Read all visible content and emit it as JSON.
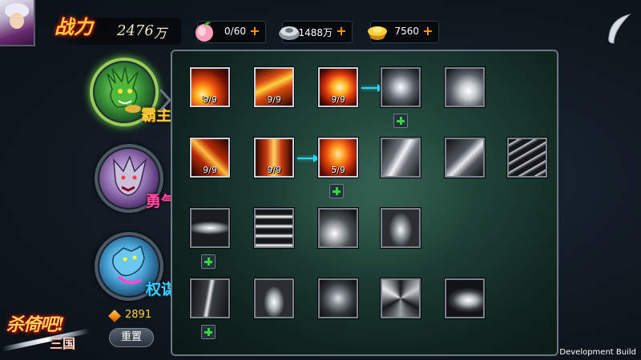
{
  "header": {
    "power_label": "战力",
    "power_value": "2476",
    "power_unit": "万",
    "resources": [
      {
        "icon": "peach-icon",
        "value": "0/60"
      },
      {
        "icon": "silver-icon",
        "value": "1488万"
      },
      {
        "icon": "gold-ingot-icon",
        "value": "7560"
      }
    ]
  },
  "specs": [
    {
      "name": "霸主",
      "icon": "dragon-icon",
      "active": true
    },
    {
      "name": "勇气",
      "icon": "wolf-icon",
      "active": false
    },
    {
      "name": "权谋",
      "icon": "serpent-icon",
      "active": false
    }
  ],
  "points": "2891",
  "reset_label": "重置",
  "logo": {
    "line1": "杀倚吧!",
    "line2": "三国"
  },
  "skills": {
    "r1c1": {
      "level": "9/9"
    },
    "r1c2": {
      "level": "9/9"
    },
    "r1c3": {
      "level": "9/9"
    },
    "r2c1": {
      "level": "9/9"
    },
    "r2c2": {
      "level": "9/9"
    },
    "r2c3": {
      "level": "5/9"
    }
  },
  "footer": {
    "dev_build": "Development Build"
  },
  "colors": {
    "accent_link": "#2ad8f2",
    "plus_green": "#37d83b",
    "gold": "#ffd23a"
  }
}
